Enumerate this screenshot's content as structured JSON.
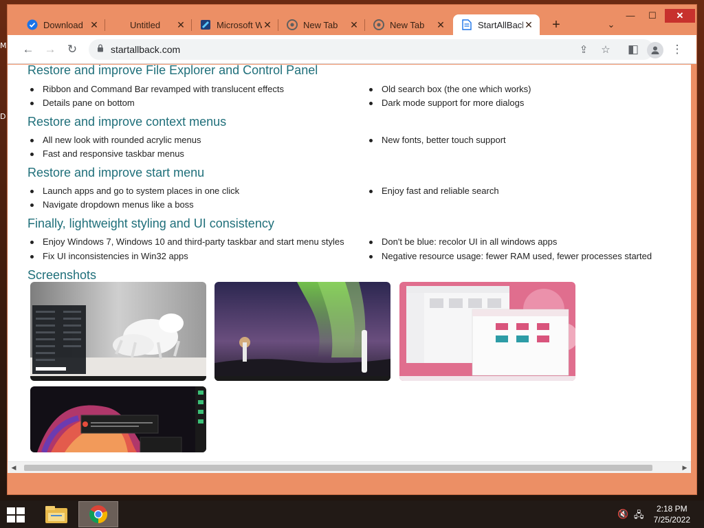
{
  "desktop": {
    "scrap_m": "M",
    "scrap_d": "D"
  },
  "tabs": [
    {
      "title": "Download",
      "icon": "checkmark-badge-icon",
      "active": false
    },
    {
      "title": "Untitled",
      "icon": "blank-icon",
      "active": false
    },
    {
      "title": "Microsoft W",
      "icon": "microsoft-blue-icon",
      "active": false
    },
    {
      "title": "New Tab",
      "icon": "chrome-icon",
      "active": false
    },
    {
      "title": "New Tab",
      "icon": "chrome-icon",
      "active": false
    },
    {
      "title": "StartAllBack",
      "icon": "page-icon",
      "active": true
    }
  ],
  "tab_close_glyph": "✕",
  "new_tab_glyph": "+",
  "tab_search_glyph": "⌄",
  "window_controls": {
    "minimize": "—",
    "maximize": "☐",
    "close": "✕"
  },
  "toolbar": {
    "back": "←",
    "forward": "→",
    "reload": "↻",
    "url": "startallback.com",
    "share": "⇪",
    "bookmark": "☆",
    "sidepanel": "◧",
    "menu": "⋮"
  },
  "sections": [
    {
      "heading": "Restore and improve File Explorer and Control Panel",
      "left": [
        "Ribbon and Command Bar revamped with translucent effects",
        "Details pane on bottom"
      ],
      "right": [
        "Old search box (the one which works)",
        "Dark mode support for more dialogs"
      ]
    },
    {
      "heading": "Restore and improve context menus",
      "left": [
        "All new look with rounded acrylic menus",
        "Fast and responsive taskbar menus"
      ],
      "right": [
        "New fonts, better touch support"
      ]
    },
    {
      "heading": "Restore and improve start menu",
      "left": [
        "Launch apps and go to system places in one click",
        "Navigate dropdown menus like a boss"
      ],
      "right": [
        "Enjoy fast and reliable search"
      ]
    },
    {
      "heading": "Finally, lightweight styling and UI consistency",
      "left": [
        "Enjoy Windows 7, Windows 10 and third-party taskbar and start menu styles",
        "Fix UI inconsistencies in Win32 apps"
      ],
      "right": [
        "Don't be blue: recolor UI in all windows apps",
        "Negative resource usage: fewer RAM used, fewer processes started"
      ]
    }
  ],
  "screenshots_heading": "Screenshots",
  "screenshots": [
    {
      "name": "screenshot-white-horses"
    },
    {
      "name": "screenshot-aurora-lighthouse"
    },
    {
      "name": "screenshot-pink-explorer"
    },
    {
      "name": "screenshot-dark-swirl"
    }
  ],
  "scrollbar": {
    "left_arrow": "◀",
    "right_arrow": "▶"
  },
  "taskbar": {
    "apps": [
      {
        "name": "file-explorer-icon",
        "active": false
      },
      {
        "name": "chrome-icon",
        "active": true
      }
    ],
    "tray": {
      "volume": "🔇",
      "network": "🖧"
    },
    "time": "2:18 PM",
    "date": "7/25/2022"
  },
  "colors": {
    "window_frame": "#ec8f65",
    "heading": "#1f6f7a",
    "taskbar": "#221a16"
  }
}
